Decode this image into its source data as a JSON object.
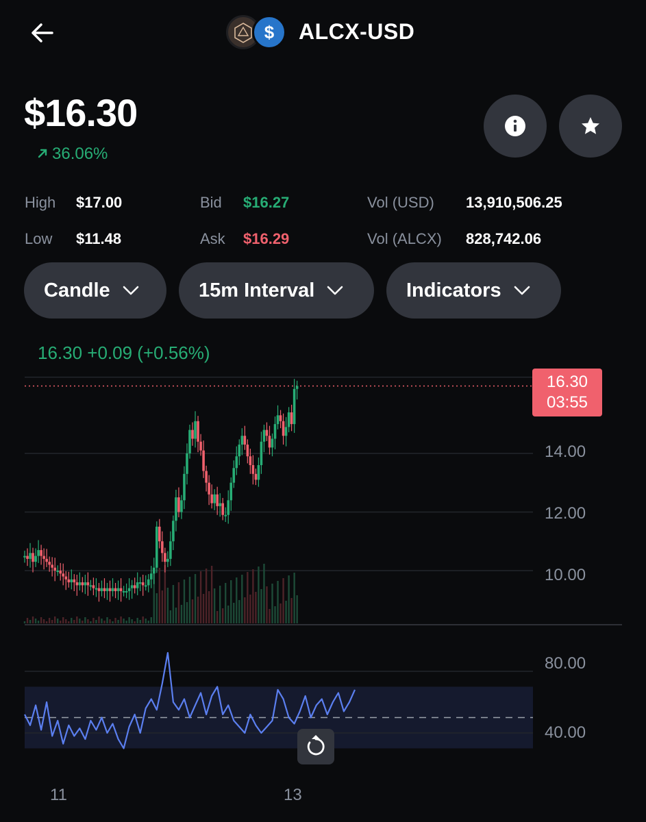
{
  "header": {
    "title": "ALCX-USD",
    "back_icon": "arrow-left-icon",
    "logo_base_icon": "alchemix-logo-icon",
    "logo_quote_glyph": "$"
  },
  "price": {
    "value": "$16.30",
    "change": "36.06%",
    "change_icon": "arrow-up-right-icon"
  },
  "actions": {
    "info_icon": "info-icon",
    "star_icon": "star-icon"
  },
  "stats": {
    "high_label": "High",
    "high_value": "$17.00",
    "low_label": "Low",
    "low_value": "$11.48",
    "bid_label": "Bid",
    "bid_value": "$16.27",
    "ask_label": "Ask",
    "ask_value": "$16.29",
    "vol_usd_label": "Vol (USD)",
    "vol_usd_value": "13,910,506.25",
    "vol_alcx_label": "Vol (ALCX)",
    "vol_alcx_value": "828,742.06"
  },
  "controls": {
    "chart_type": "Candle",
    "interval": "15m Interval",
    "indicators": "Indicators"
  },
  "chart": {
    "ohlc_label": "16.30  +0.09  (+0.56%)",
    "last_price": "16.30",
    "countdown": "03:55",
    "reset_icon": "reset-icon",
    "colors": {
      "up": "#27ad75",
      "down": "#f0616d",
      "rsi": "#5b7ff0"
    }
  },
  "chart_data": [
    {
      "type": "candlestick",
      "title": "",
      "y_tick_labels": [
        "14.00",
        "12.00",
        "10.00"
      ],
      "ylim": [
        8.2,
        17.2
      ],
      "grid": true,
      "x_tick_labels": [
        "11",
        "13"
      ],
      "x": [
        0,
        2,
        4,
        6,
        8,
        10,
        12,
        14,
        16,
        18,
        20,
        22,
        24,
        26,
        28,
        30,
        32,
        34,
        36,
        38,
        40,
        42,
        44,
        46,
        48,
        50,
        52,
        54,
        56,
        58,
        60,
        62,
        64,
        66,
        68,
        70,
        72,
        74,
        76,
        78,
        80,
        82,
        84,
        86,
        88,
        90,
        92,
        94,
        96,
        98,
        100,
        102,
        104,
        106,
        108,
        110,
        112,
        114,
        116,
        118,
        120,
        122,
        124,
        126,
        128,
        130,
        132,
        134,
        136,
        138,
        140,
        142,
        144,
        146,
        148,
        150,
        152,
        154,
        156,
        158,
        160,
        162,
        164,
        166,
        168,
        170,
        172,
        174,
        176,
        178,
        180,
        182,
        184,
        186,
        188,
        190,
        192,
        194,
        196,
        198,
        200,
        202,
        204,
        206,
        208,
        210,
        212,
        214,
        216,
        218,
        220,
        222,
        224,
        226,
        228,
        230,
        232,
        234,
        236,
        238,
        240
      ],
      "close": [
        10.5,
        10.4,
        10.6,
        10.3,
        10.5,
        10.7,
        10.5,
        10.4,
        10.3,
        10.2,
        10.1,
        10.0,
        10.0,
        9.9,
        9.8,
        9.7,
        9.6,
        9.7,
        9.6,
        9.5,
        9.6,
        9.5,
        9.6,
        9.5,
        9.5,
        9.4,
        9.4,
        9.3,
        9.4,
        9.3,
        9.4,
        9.3,
        9.4,
        9.3,
        9.4,
        9.3,
        9.3,
        9.3,
        9.4,
        9.5,
        9.4,
        9.6,
        9.6,
        9.5,
        9.5,
        9.7,
        9.9,
        10.1,
        11.5,
        11.0,
        10.6,
        10.3,
        10.4,
        11.0,
        11.7,
        12.5,
        12.0,
        12.4,
        13.3,
        14.0,
        14.8,
        14.5,
        15.1,
        14.4,
        14.1,
        13.4,
        13.0,
        12.6,
        12.3,
        12.6,
        12.2,
        12.3,
        11.9,
        11.9,
        12.4,
        13.0,
        13.5,
        13.9,
        14.3,
        14.6,
        14.3,
        13.9,
        13.6,
        13.3,
        13.1,
        13.6,
        14.4,
        14.8,
        14.6,
        14.2,
        14.5,
        15.0,
        15.3,
        15.1,
        14.6,
        14.9,
        15.4,
        15.0,
        16.2,
        16.3
      ],
      "volume_present": true
    },
    {
      "type": "line",
      "title": "",
      "y_tick_labels": [
        "80.00",
        "40.00"
      ],
      "ylim": [
        20,
        100
      ],
      "x": [
        0,
        3,
        6,
        9,
        12,
        15,
        18,
        21,
        24,
        27,
        30,
        33,
        36,
        39,
        42,
        45,
        48,
        51,
        54,
        57,
        60,
        63,
        66,
        69,
        72,
        75,
        78,
        81,
        84,
        87,
        90,
        93,
        96,
        99,
        102,
        105,
        108,
        111,
        114,
        117,
        120,
        123,
        126,
        129,
        132,
        135,
        138,
        141,
        144,
        147,
        150,
        153,
        156,
        159,
        162,
        165,
        168,
        171,
        174,
        177,
        180
      ],
      "series": [
        {
          "values": [
            52,
            45,
            58,
            42,
            60,
            38,
            48,
            33,
            45,
            38,
            43,
            36,
            48,
            42,
            50,
            40,
            46,
            36,
            30,
            44,
            52,
            40,
            56,
            62,
            55,
            72,
            92,
            60,
            55,
            62,
            50,
            58,
            66,
            52,
            64,
            70,
            52,
            58,
            48,
            44,
            40,
            52,
            45,
            40,
            44,
            48,
            68,
            62,
            50,
            46,
            54,
            64,
            50,
            58,
            62,
            52,
            60,
            66,
            54,
            60,
            68
          ]
        }
      ],
      "bands": [
        30,
        70
      ],
      "midline": 50
    }
  ]
}
